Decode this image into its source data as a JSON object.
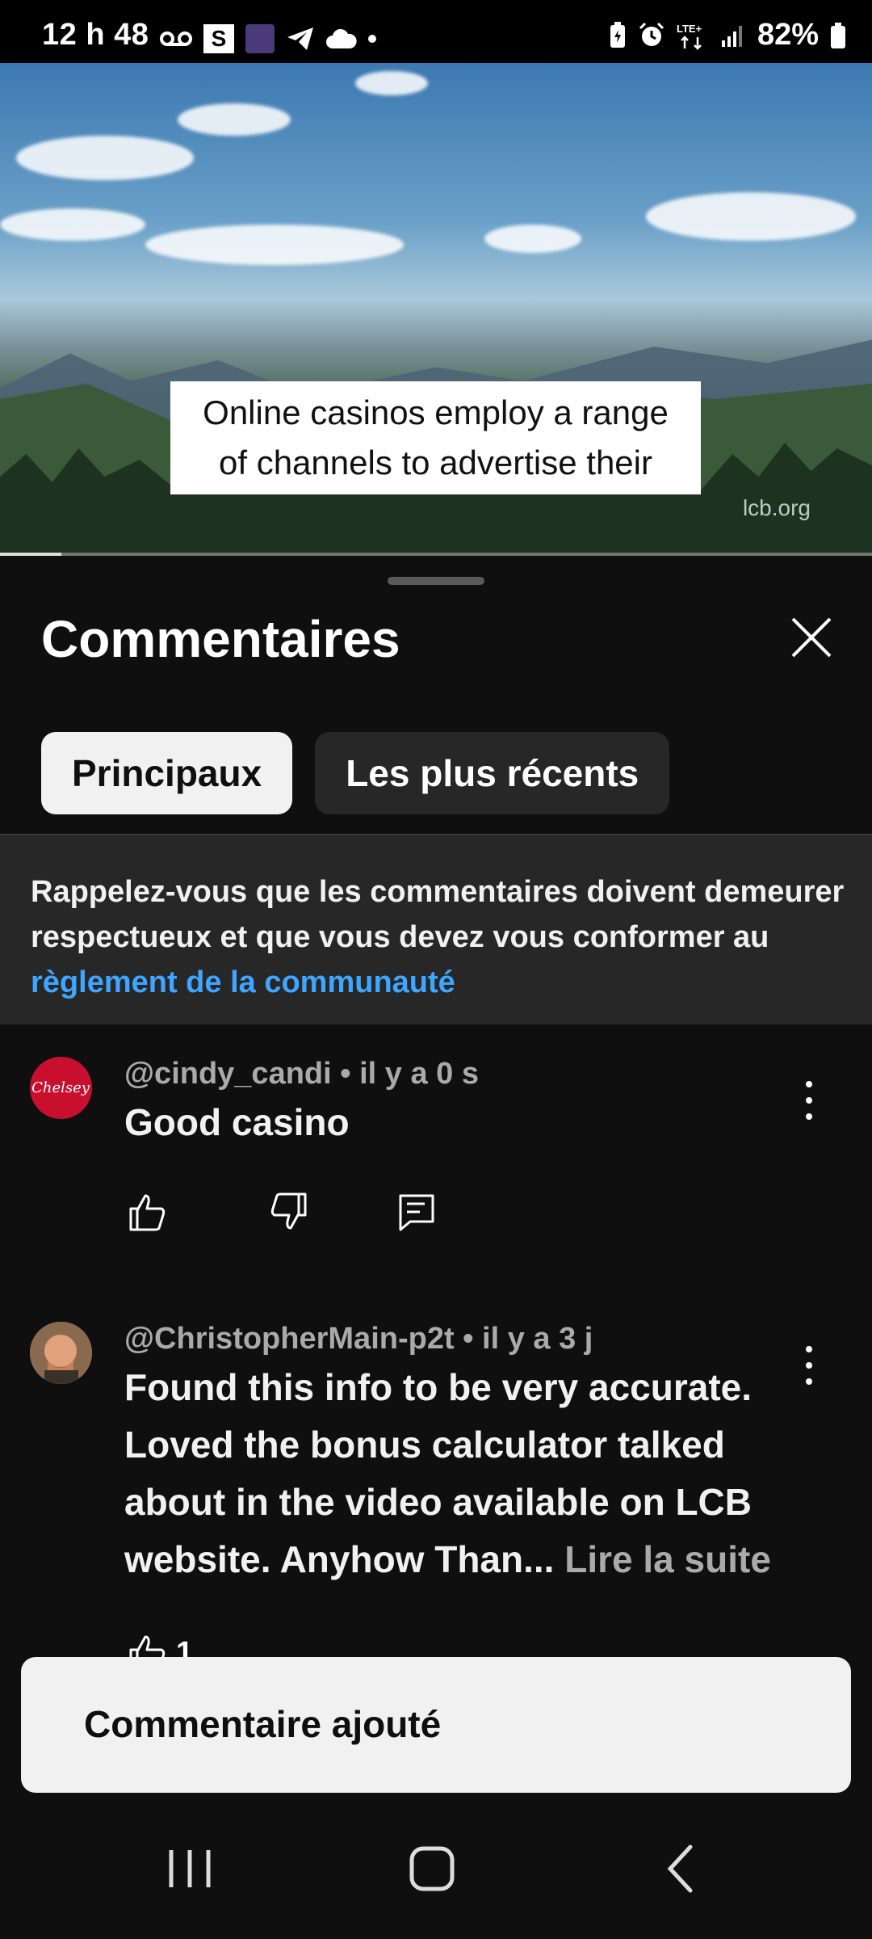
{
  "status_bar": {
    "time": "12 h 48",
    "s_badge": "S",
    "battery": "82%",
    "network": "LTE+"
  },
  "video": {
    "caption_line1": "Online casinos employ a range",
    "caption_line2": "of channels to advertise their",
    "watermark": "lcb.org",
    "progress_percent": 7
  },
  "comments_panel": {
    "title": "Commentaires",
    "tabs": [
      {
        "label": "Principaux",
        "active": true
      },
      {
        "label": "Les plus récents",
        "active": false
      }
    ],
    "notice": {
      "text": "Rappelez-vous que les commentaires doivent demeurer respectueux et que vous devez vous conformer au ",
      "link": "règlement de la communauté"
    },
    "comments": [
      {
        "author": "@cindy_candi",
        "time": "il y a 0 s",
        "text": "Good casino",
        "avatar": "chelsey-logo",
        "avatar_text": "Chelsey"
      },
      {
        "author": "@ChristopherMain-p2t",
        "time": "il y a 3 j",
        "text": "Found this info to be very accurate. Loved the bonus calculator talked about in the video available on LCB website. Anyhow Than...",
        "read_more": "Lire la suite",
        "likes": "1",
        "avatar": "person-photo"
      }
    ]
  },
  "snackbar": {
    "text": "Commentaire ajouté"
  },
  "icons": [
    "voicemail-icon",
    "s-app-icon",
    "brain-icon",
    "telegram-icon",
    "cloud-icon",
    "battery-saver-icon",
    "alarm-icon",
    "signal-icon",
    "battery-icon",
    "close-icon",
    "thumb-up-icon",
    "thumb-down-icon",
    "reply-icon",
    "more-vert-icon",
    "recents-icon",
    "home-icon",
    "back-icon"
  ],
  "colors": {
    "link": "#3ea6ff",
    "background": "#0f0f0f",
    "surface": "#272727"
  }
}
